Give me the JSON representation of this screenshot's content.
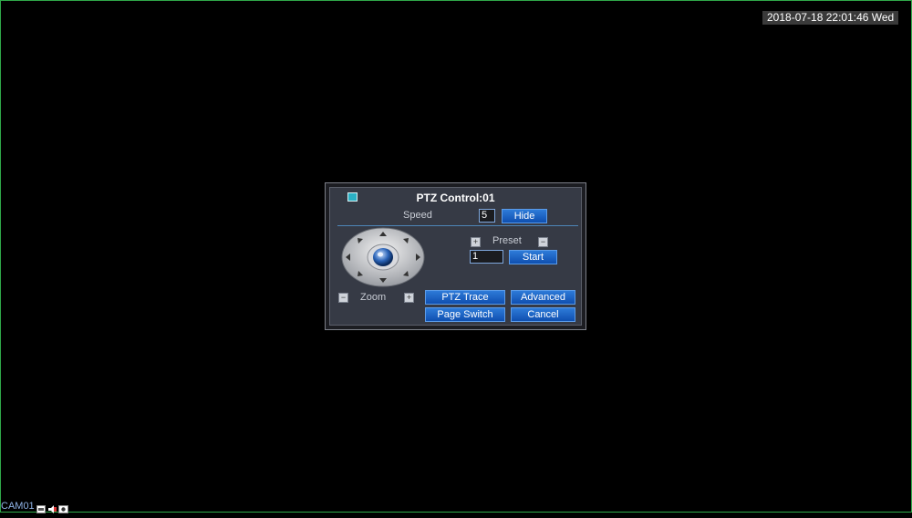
{
  "screen": {
    "datetime": "2018-07-18 22:01:46 Wed",
    "camera_label": "CAM01"
  },
  "dialog": {
    "title": "PTZ Control:01",
    "speed_label": "Speed",
    "speed_value": "5",
    "hide_button": "Hide",
    "preset_label": "Preset",
    "preset_value": "1",
    "start_button": "Start",
    "zoom_label": "Zoom",
    "ptz_trace_button": "PTZ Trace",
    "advanced_button": "Advanced",
    "page_switch_button": "Page Switch",
    "cancel_button": "Cancel"
  },
  "colors": {
    "button": "#1f63c4",
    "dialog_bg": "#363a45",
    "separator": "#4d86b8",
    "frame_border": "#2fa84a"
  },
  "icons": [
    "ptz-dialog-icon",
    "directional-pad-icon",
    "record-icon",
    "audio-icon",
    "camera-icon"
  ]
}
